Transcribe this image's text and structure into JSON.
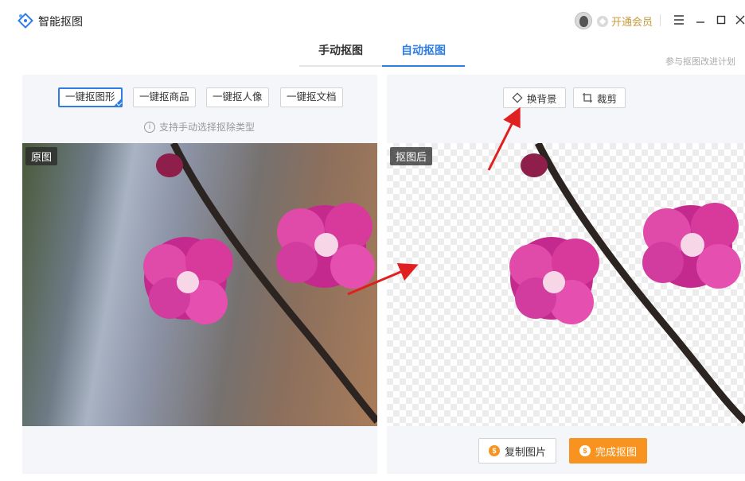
{
  "app": {
    "title": "智能抠图"
  },
  "titlebar": {
    "vip_label": "开通会员"
  },
  "tabs": [
    {
      "label": "手动抠图",
      "active": false
    },
    {
      "label": "自动抠图",
      "active": true
    }
  ],
  "plan_link": "参与抠图改进计划",
  "left_panel": {
    "options": [
      {
        "label": "一键抠图形",
        "selected": true
      },
      {
        "label": "一键抠商品",
        "selected": false
      },
      {
        "label": "一键抠人像",
        "selected": false
      },
      {
        "label": "一键抠文档",
        "selected": false
      }
    ],
    "hint": "支持手动选择抠除类型",
    "image_label": "原图"
  },
  "right_panel": {
    "tools": [
      {
        "label": "换背景",
        "icon": "diamond-icon"
      },
      {
        "label": "裁剪",
        "icon": "crop-icon"
      }
    ],
    "image_label": "抠图后",
    "copy_label": "复制图片",
    "done_label": "完成抠图"
  },
  "colors": {
    "accent": "#2f7de1",
    "action": "#f7931e",
    "annotation_arrow": "#e02020",
    "flower": "#d8369a"
  }
}
